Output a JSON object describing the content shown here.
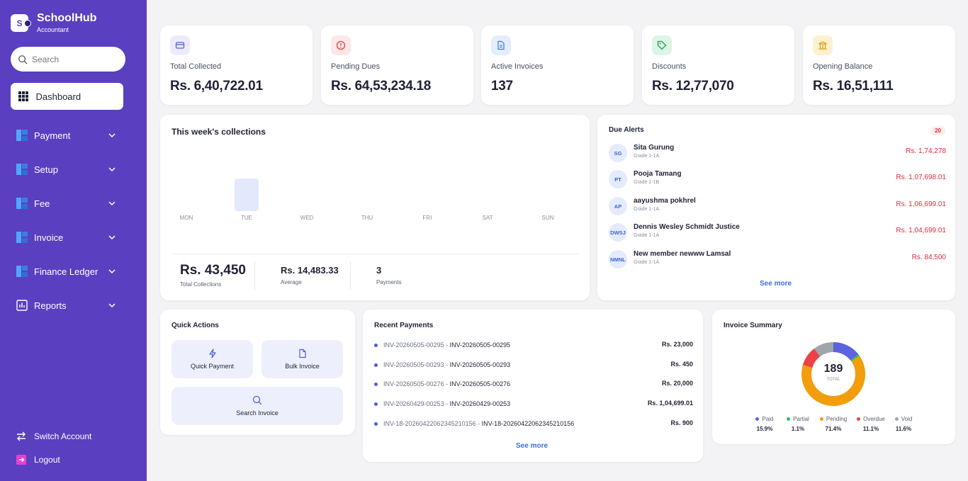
{
  "brand": {
    "name": "SchoolHub",
    "role": "Accountant",
    "logo_letter": "S"
  },
  "sidebar": {
    "search_placeholder": "Search",
    "dashboard_label": "Dashboard",
    "items": [
      {
        "label": "Payment"
      },
      {
        "label": "Setup"
      },
      {
        "label": "Fee"
      },
      {
        "label": "Invoice"
      },
      {
        "label": "Finance Ledger"
      },
      {
        "label": "Reports"
      }
    ],
    "switch_account": "Switch Account",
    "logout": "Logout"
  },
  "stats": [
    {
      "label": "Total Collected",
      "value": "Rs. 6,40,722.01",
      "icon": "card-icon",
      "color": "#5a63d8",
      "bg": "#ecebfd"
    },
    {
      "label": "Pending Dues",
      "value": "Rs. 64,53,234.18",
      "icon": "alert-circle-icon",
      "color": "#e0433f",
      "bg": "#fde7e7"
    },
    {
      "label": "Active Invoices",
      "value": "137",
      "icon": "document-icon",
      "color": "#3e78e0",
      "bg": "#e3edfc"
    },
    {
      "label": "Discounts",
      "value": "Rs. 12,77,070",
      "icon": "tag-icon",
      "color": "#1f9d57",
      "bg": "#dcf5e6"
    },
    {
      "label": "Opening Balance",
      "value": "Rs. 16,51,111",
      "icon": "bank-icon",
      "color": "#d89a0b",
      "bg": "#fdf1cf"
    }
  ],
  "weekly": {
    "title": "This week's collections",
    "total_value": "Rs. 43,450",
    "total_label": "Total Collections",
    "average_value": "Rs. 14,483.33",
    "average_label": "Average",
    "payments_value": "3",
    "payments_label": "Payments"
  },
  "chart_data": {
    "type": "bar",
    "categories": [
      "MON",
      "TUE",
      "WED",
      "THU",
      "FRI",
      "SAT",
      "SUN"
    ],
    "values": [
      0,
      43450,
      0,
      0,
      0,
      0,
      0
    ],
    "color": "#e4e8fd"
  },
  "due_alerts": {
    "title": "Due Alerts",
    "count": "20",
    "see_more": "See more",
    "items": [
      {
        "initials": "SG",
        "name": "Sita Gurung",
        "grade": "Grade 1-1A",
        "amount": "Rs. 1,74,278"
      },
      {
        "initials": "PT",
        "name": "Pooja Tamang",
        "grade": "Grade 1-1B",
        "amount": "Rs. 1,07,698.01"
      },
      {
        "initials": "AP",
        "name": "aayushma pokhrel",
        "grade": "Grade 1-1A",
        "amount": "Rs. 1,06,699.01"
      },
      {
        "initials": "DWSJ",
        "name": "Dennis Wesley Schmidt Justice",
        "grade": "Grade 1-1A",
        "amount": "Rs. 1,04,699.01"
      },
      {
        "initials": "NMNL",
        "name": "New member newww Lamsal",
        "grade": "Grade 1-1A",
        "amount": "Rs. 84,500"
      }
    ]
  },
  "quick_actions": {
    "title": "Quick Actions",
    "quick_payment": "Quick Payment",
    "bulk_invoice": "Bulk Invoice",
    "search_invoice": "Search Invoice"
  },
  "recent_payments": {
    "title": "Recent Payments",
    "see_more": "See more",
    "items": [
      {
        "ref": "INV-20260505-00295",
        "invoice": "INV-20260505-00295",
        "amount": "Rs. 23,000"
      },
      {
        "ref": "INV-20260505-00293",
        "invoice": "INV-20260505-00293",
        "amount": "Rs. 450"
      },
      {
        "ref": "INV-20260505-00276",
        "invoice": "INV-20260505-00276",
        "amount": "Rs. 20,000"
      },
      {
        "ref": "INV-20260429-00253",
        "invoice": "INV-20260429-00253",
        "amount": "Rs. 1,04,699.01"
      },
      {
        "ref": "INV-18-20260422062345210156",
        "invoice": "INV-18-20260422062345210156",
        "amount": "Rs. 900"
      }
    ]
  },
  "invoice_summary": {
    "title": "Invoice Summary",
    "total": "189",
    "total_label": "TOTAL",
    "legend": [
      {
        "label": "Paid",
        "pct": "15.9%",
        "value": 15.9,
        "color": "#5b63e0"
      },
      {
        "label": "Partial",
        "pct": "1.1%",
        "value": 1.1,
        "color": "#2fbf5a"
      },
      {
        "label": "Pending",
        "pct": "71.4%",
        "value": 71.4,
        "color": "#f29d0c"
      },
      {
        "label": "Overdue",
        "pct": "11.1%",
        "value": 11.1,
        "color": "#ec4245"
      },
      {
        "label": "Void",
        "pct": "11.6%",
        "value": 11.6,
        "color": "#a0a4ab"
      }
    ]
  }
}
